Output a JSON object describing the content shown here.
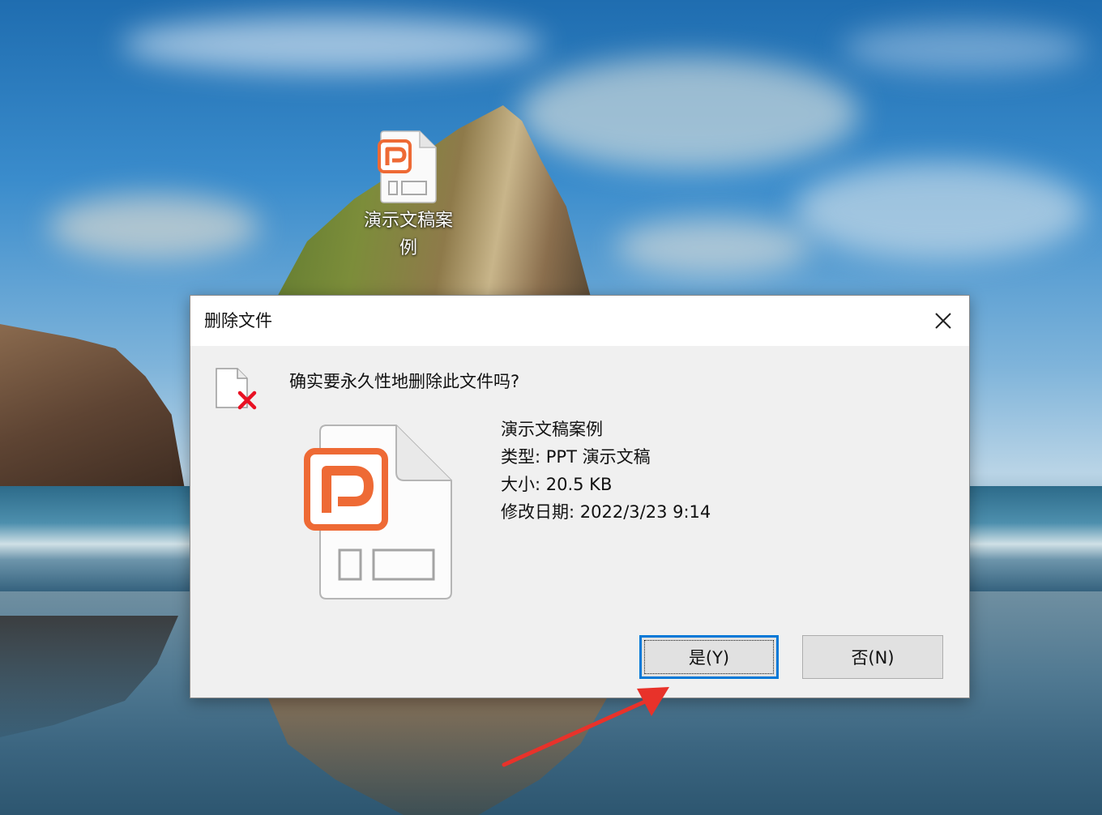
{
  "desktop": {
    "icon_label": "演示文稿案例"
  },
  "dialog": {
    "title": "删除文件",
    "question": "确实要永久性地删除此文件吗?",
    "file": {
      "name": "演示文稿案例",
      "type_line": "类型: PPT 演示文稿",
      "size_line": "大小: 20.5 KB",
      "modified_line": "修改日期: 2022/3/23 9:14"
    },
    "buttons": {
      "yes_label": "是(Y)",
      "no_label": "否(N)"
    }
  },
  "colors": {
    "ppt_orange": "#ee6a35",
    "delete_red": "#e81123",
    "focus_blue": "#0078d7",
    "annotation_arrow": "#e8322a"
  }
}
